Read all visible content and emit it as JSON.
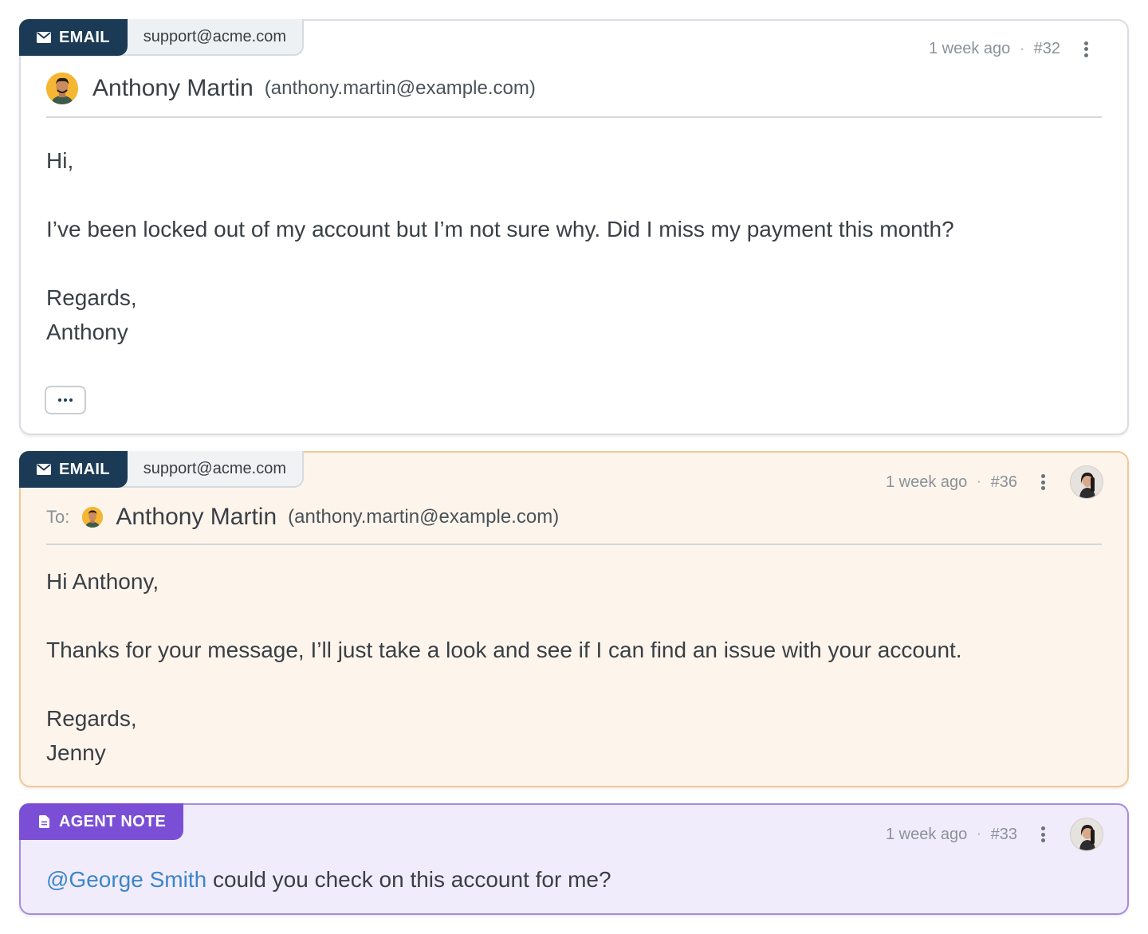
{
  "messages": [
    {
      "channel": "EMAIL",
      "mailbox": "support@acme.com",
      "time": "1 week ago",
      "dot": "·",
      "number": "#32",
      "sender_name": "Anthony Martin",
      "sender_email": "(anthony.martin@example.com)",
      "greeting": "Hi,",
      "text": "I’ve been locked out of my account but I’m not sure why. Did I miss my payment this month?",
      "signoff": "Regards,",
      "signature": "Anthony"
    },
    {
      "channel": "EMAIL",
      "mailbox": "support@acme.com",
      "time": "1 week ago",
      "dot": "·",
      "number": "#36",
      "to_label": "To:",
      "recipient_name": "Anthony Martin",
      "recipient_email": "(anthony.martin@example.com)",
      "greeting": "Hi Anthony,",
      "text": "Thanks for your message, I’ll just take a look and see if I can find an issue with your account.",
      "signoff": "Regards,",
      "signature": "Jenny"
    },
    {
      "channel": "AGENT NOTE",
      "time": "1 week ago",
      "dot": "·",
      "number": "#33",
      "mention": "@George Smith",
      "text": " could you check on this account for me?"
    }
  ],
  "icons": {
    "email": "envelope-icon",
    "note": "document-icon",
    "menu": "kebab-menu-icon",
    "expand": "ellipsis-icon"
  },
  "colors": {
    "email_tag": "#1b3a55",
    "note_tag": "#7a4fd6",
    "reply_bg": "#fdf5ec",
    "reply_border": "#f2c894",
    "note_bg": "#f1ecfb",
    "note_border": "#a58be0",
    "mention": "#3b86c9"
  }
}
